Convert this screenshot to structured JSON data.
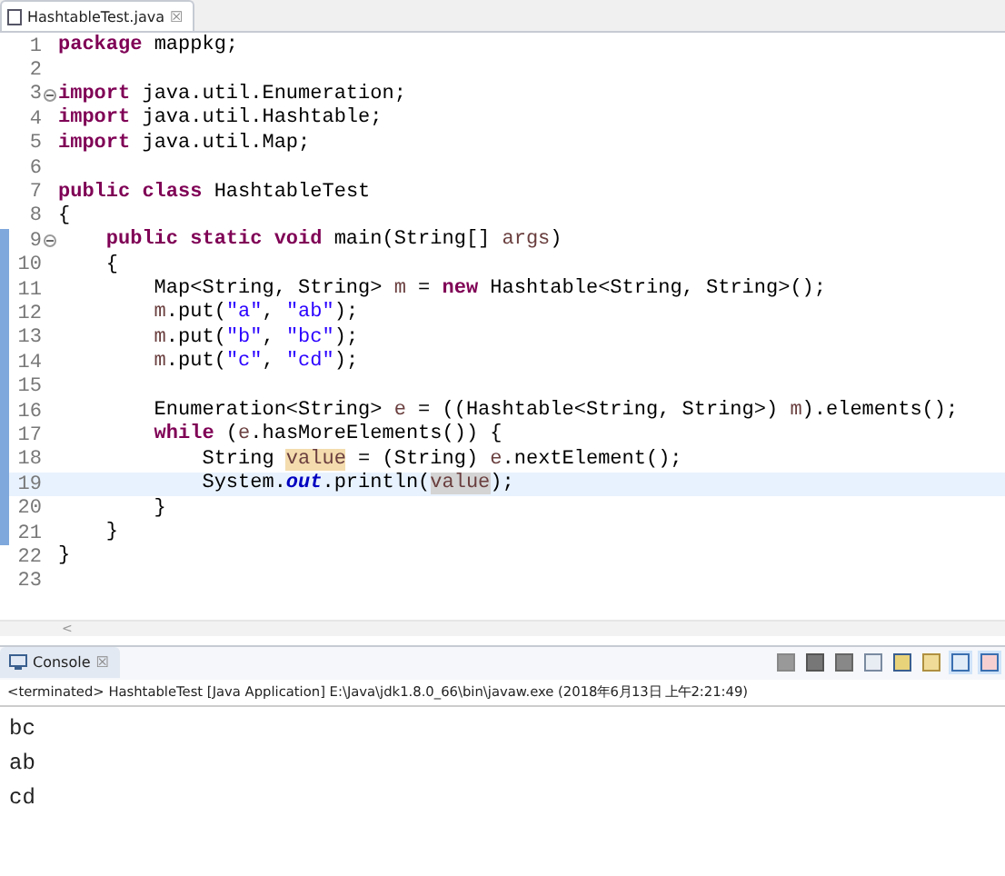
{
  "editor": {
    "tab": {
      "title": "HashtableTest.java",
      "close": "☒"
    },
    "lines": [
      {
        "number": "1",
        "fold": false,
        "changed": false,
        "current": false,
        "tokens": [
          {
            "kind": "kw",
            "text": "package "
          },
          {
            "kind": "plain",
            "text": "mappkg;"
          }
        ]
      },
      {
        "number": "2",
        "fold": false,
        "changed": false,
        "current": false
      },
      {
        "number": "3",
        "fold": true,
        "changed": false,
        "current": false,
        "tokens": [
          {
            "kind": "kw",
            "text": "import "
          },
          {
            "kind": "plain",
            "text": "java.util.Enumeration;"
          }
        ]
      },
      {
        "number": "4",
        "fold": false,
        "changed": false,
        "current": false,
        "tokens": [
          {
            "kind": "kw",
            "text": "import "
          },
          {
            "kind": "plain",
            "text": "java.util.Hashtable;"
          }
        ]
      },
      {
        "number": "5",
        "fold": false,
        "changed": false,
        "current": false,
        "tokens": [
          {
            "kind": "kw",
            "text": "import "
          },
          {
            "kind": "plain",
            "text": "java.util.Map;"
          }
        ]
      },
      {
        "number": "6",
        "fold": false,
        "changed": false,
        "current": false
      },
      {
        "number": "7",
        "fold": false,
        "changed": false,
        "current": false,
        "tokens": [
          {
            "kind": "kw",
            "text": "public class "
          },
          {
            "kind": "plain",
            "text": "HashtableTest"
          }
        ]
      },
      {
        "number": "8",
        "fold": false,
        "changed": false,
        "current": false,
        "tokens": [
          {
            "kind": "plain",
            "text": "{"
          }
        ]
      },
      {
        "number": "9",
        "fold": true,
        "changed": true,
        "current": false,
        "tokens": [
          {
            "kind": "kw",
            "text": "    public static void "
          },
          {
            "kind": "plain",
            "text": "main(String[] "
          },
          {
            "kind": "var",
            "text": "args"
          },
          {
            "kind": "plain",
            "text": ")"
          }
        ]
      },
      {
        "number": "10",
        "fold": false,
        "changed": true,
        "current": false,
        "tokens": [
          {
            "kind": "plain",
            "text": "    {"
          }
        ]
      },
      {
        "number": "11",
        "fold": false,
        "changed": true,
        "current": false,
        "tokens": [
          {
            "kind": "plain",
            "text": "        Map<String, String> "
          },
          {
            "kind": "var",
            "text": "m"
          },
          {
            "kind": "plain",
            "text": " = "
          },
          {
            "kind": "kw",
            "text": "new "
          },
          {
            "kind": "plain",
            "text": "Hashtable<String, String>();"
          }
        ]
      },
      {
        "number": "12",
        "fold": false,
        "changed": true,
        "current": false,
        "tokens": [
          {
            "kind": "var",
            "text": "        m"
          },
          {
            "kind": "plain",
            "text": ".put("
          },
          {
            "kind": "str",
            "text": "\"a\""
          },
          {
            "kind": "plain",
            "text": ", "
          },
          {
            "kind": "str",
            "text": "\"ab\""
          },
          {
            "kind": "plain",
            "text": ");"
          }
        ]
      },
      {
        "number": "13",
        "fold": false,
        "changed": true,
        "current": false,
        "tokens": [
          {
            "kind": "var",
            "text": "        m"
          },
          {
            "kind": "plain",
            "text": ".put("
          },
          {
            "kind": "str",
            "text": "\"b\""
          },
          {
            "kind": "plain",
            "text": ", "
          },
          {
            "kind": "str",
            "text": "\"bc\""
          },
          {
            "kind": "plain",
            "text": ");"
          }
        ]
      },
      {
        "number": "14",
        "fold": false,
        "changed": true,
        "current": false,
        "tokens": [
          {
            "kind": "var",
            "text": "        m"
          },
          {
            "kind": "plain",
            "text": ".put("
          },
          {
            "kind": "str",
            "text": "\"c\""
          },
          {
            "kind": "plain",
            "text": ", "
          },
          {
            "kind": "str",
            "text": "\"cd\""
          },
          {
            "kind": "plain",
            "text": ");"
          }
        ]
      },
      {
        "number": "15",
        "fold": false,
        "changed": true,
        "current": false
      },
      {
        "number": "16",
        "fold": false,
        "changed": true,
        "current": false,
        "tokens": [
          {
            "kind": "plain",
            "text": "        Enumeration<String> "
          },
          {
            "kind": "var",
            "text": "e"
          },
          {
            "kind": "plain",
            "text": " = ((Hashtable<String, String>) "
          },
          {
            "kind": "var",
            "text": "m"
          },
          {
            "kind": "plain",
            "text": ").elements();"
          }
        ]
      },
      {
        "number": "17",
        "fold": false,
        "changed": true,
        "current": false,
        "tokens": [
          {
            "kind": "kw",
            "text": "        while "
          },
          {
            "kind": "plain",
            "text": "("
          },
          {
            "kind": "var",
            "text": "e"
          },
          {
            "kind": "plain",
            "text": ".hasMoreElements()) {"
          }
        ]
      },
      {
        "number": "18",
        "fold": false,
        "changed": true,
        "current": false,
        "tokens": [
          {
            "kind": "plain",
            "text": "            String "
          },
          {
            "kind": "write",
            "text": "value"
          },
          {
            "kind": "plain",
            "text": " = (String) "
          },
          {
            "kind": "var",
            "text": "e"
          },
          {
            "kind": "plain",
            "text": ".nextElement();"
          }
        ]
      },
      {
        "number": "19",
        "fold": false,
        "changed": true,
        "current": true,
        "tokens": [
          {
            "kind": "plain",
            "text": "            System."
          },
          {
            "kind": "static",
            "text": "out"
          },
          {
            "kind": "plain",
            "text": ".println("
          },
          {
            "kind": "read",
            "text": "value"
          },
          {
            "kind": "plain",
            "text": ");"
          }
        ]
      },
      {
        "number": "20",
        "fold": false,
        "changed": true,
        "current": false,
        "tokens": [
          {
            "kind": "plain",
            "text": "        }"
          }
        ]
      },
      {
        "number": "21",
        "fold": false,
        "changed": true,
        "current": false,
        "tokens": [
          {
            "kind": "plain",
            "text": "    }"
          }
        ]
      },
      {
        "number": "22",
        "fold": false,
        "changed": false,
        "current": false,
        "tokens": [
          {
            "kind": "plain",
            "text": "}"
          }
        ]
      },
      {
        "number": "23",
        "fold": false,
        "changed": false,
        "current": false
      }
    ],
    "scroll_left": "<"
  },
  "console": {
    "tab": {
      "title": "Console",
      "close": "☒"
    },
    "status": "<terminated> HashtableTest [Java Application] E:\\Java\\jdk1.8.0_66\\bin\\javaw.exe (2018年6月13日 上午2:21:49)",
    "output": [
      "bc",
      "ab",
      "cd"
    ]
  }
}
